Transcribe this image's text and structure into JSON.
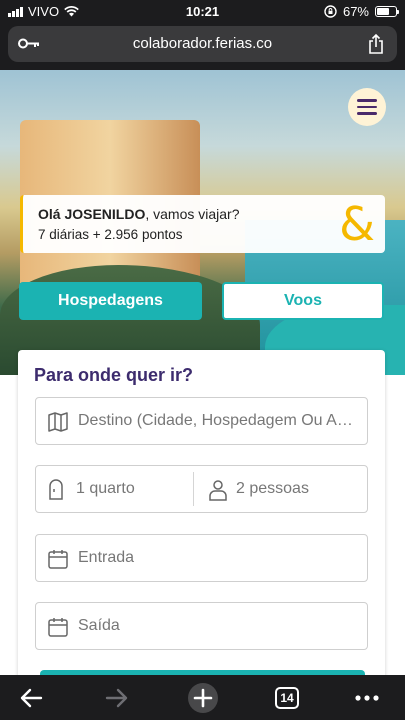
{
  "status_bar": {
    "carrier": "VIVO",
    "time": "10:21",
    "battery": "67%",
    "battery_level": 0.67
  },
  "browser": {
    "url": "colaborador.ferias.co",
    "tabs_count": "14"
  },
  "greeting": {
    "hello": "Olá JOSENILDO",
    "suffix": ", vamos viajar?",
    "balance": "7 diárias + 2.956 pontos",
    "logo_glyph": "&"
  },
  "tabs": {
    "lodging": "Hospedagens",
    "flights": "Voos"
  },
  "form": {
    "title": "Para onde quer ir?",
    "destination_placeholder": "Destino (Cidade, Hospedagem Ou Aeroporto)",
    "rooms": "1 quarto",
    "guests": "2 pessoas",
    "checkin_placeholder": "Entrada",
    "checkout_placeholder": "Saída"
  },
  "colors": {
    "accent": "#1bb3b2",
    "brand_yellow": "#f5b800",
    "title_purple": "#3d2c6e"
  }
}
